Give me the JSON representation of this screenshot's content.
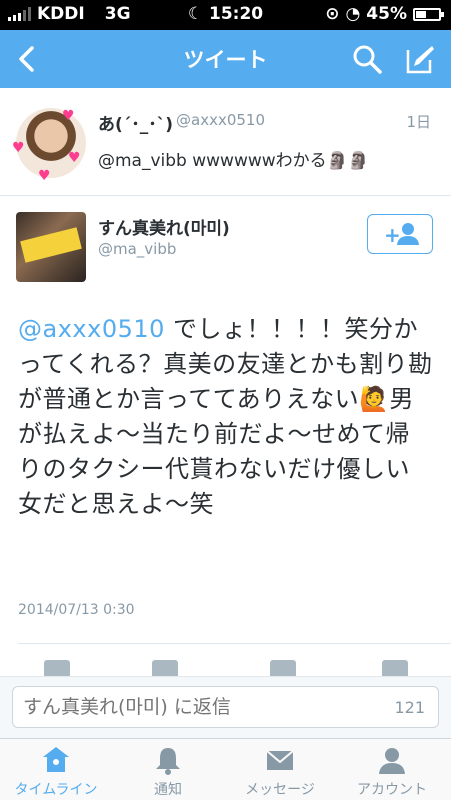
{
  "status_bar": {
    "carrier": "KDDI",
    "network": "3G",
    "time": "15:20",
    "battery": "45%",
    "battery_level": 0.45
  },
  "nav": {
    "title": "ツイート",
    "icons": [
      "back-icon",
      "search-icon",
      "compose-icon"
    ]
  },
  "parent_tweet": {
    "name": "あ(´･_･`)",
    "handle": "@axxx0510",
    "time": "1日",
    "text": "@ma_vibb wwwwwwわかる🗿🗿"
  },
  "tweet": {
    "name": "すん真美れ(마미)",
    "handle": "@ma_vibb",
    "mention": "@axxx0510",
    "text": " でしょ！！！！笑分かってくれる？真美の友達とかも割り勘が普通とか言っててありえない🙋男が払えよ〜当たり前だよ〜せめて帰りのタクシー代貰わないだけ優しい女だと思えよ〜笑",
    "date": "2014/07/13 0:30",
    "follow_icon": "add-user-icon"
  },
  "reply": {
    "placeholder": "すん真美れ(마미) に返信",
    "count": "121"
  },
  "tabs": [
    {
      "label": "タイムライン",
      "icon": "home-icon",
      "active": true
    },
    {
      "label": "通知",
      "icon": "bell-icon",
      "active": false
    },
    {
      "label": "メッセージ",
      "icon": "envelope-icon",
      "active": false
    },
    {
      "label": "アカウント",
      "icon": "person-icon",
      "active": false
    }
  ],
  "colors": {
    "accent": "#55acee",
    "text": "#292f33",
    "muted": "#8899a6"
  }
}
